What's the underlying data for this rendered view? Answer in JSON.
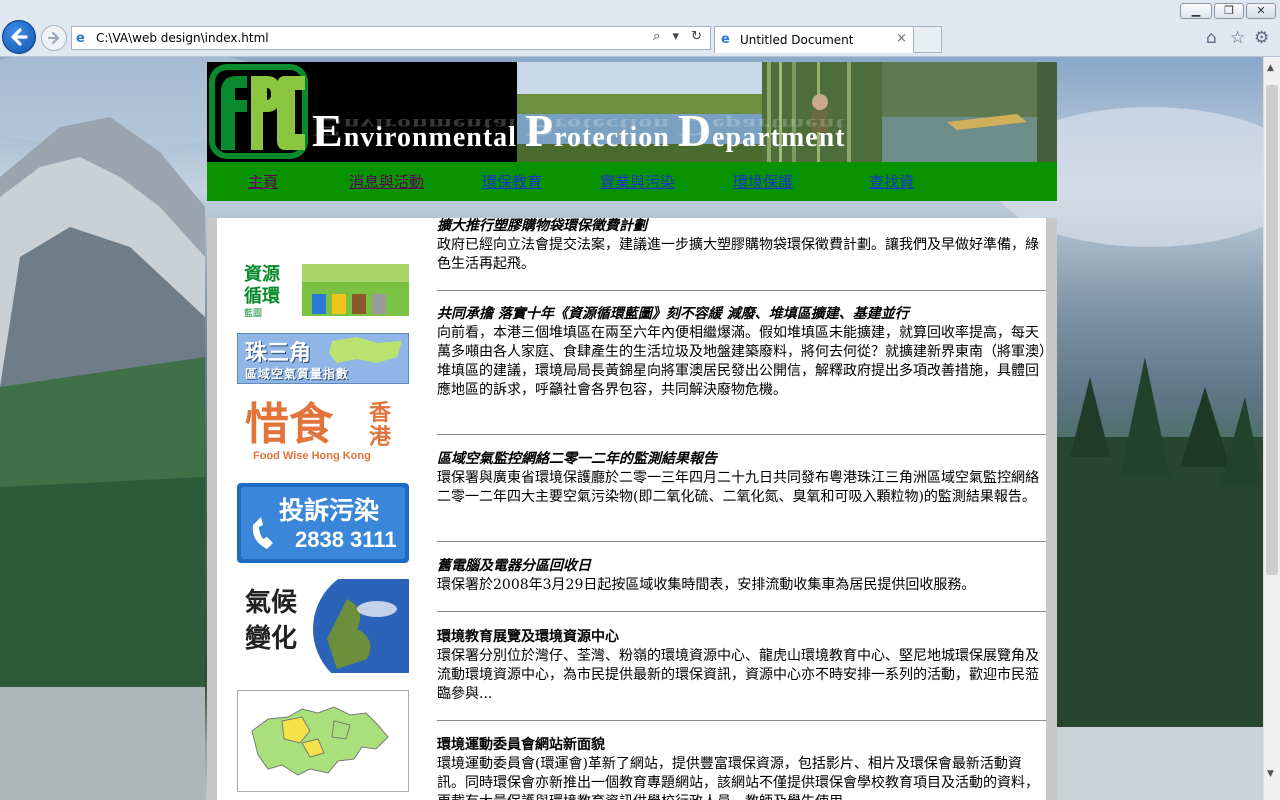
{
  "browser": {
    "address_url": "C:\\VA\\web design\\index.html",
    "tab_title": "Untitled Document",
    "tab_close": "×",
    "address_tools": "⌕ ▾ ↻"
  },
  "banner": {
    "title_e": "E",
    "title_rest1": "nvironmental ",
    "title_p": "P",
    "title_rest2": "rotection ",
    "title_d": "D",
    "title_rest3": "epartment"
  },
  "nav": {
    "items": [
      {
        "label": "主頁",
        "color": "#5a005a"
      },
      {
        "label": "消息與活動",
        "color": "#5a005a"
      },
      {
        "label": "環保教育",
        "color": "#1a35c8"
      },
      {
        "label": "實業與污染",
        "color": "#1a35c8"
      },
      {
        "label": "環境保護",
        "color": "#1a35c8"
      },
      {
        "label": "查找資",
        "color": "#1a35c8"
      }
    ]
  },
  "sidebar": {
    "recycle_text": "資源\n循環",
    "recycle_sub": "藍圖",
    "prd_text": "珠三角",
    "prd_sub": "區域空氣質量指數",
    "foodwise_cn": "惜食",
    "foodwise_cn2": "香港",
    "foodwise_en": "Food Wise Hong Kong",
    "complaint_text": "投訴污染",
    "complaint_phone": "2838 3111",
    "climate_text": "氣候\n變化"
  },
  "articles": [
    {
      "title": "擴大推行塑膠購物袋環保徵費計劃",
      "body": "政府已經向立法會提交法案，建議進一步擴大塑膠購物袋環保徵費計劃。讓我們及早做好準備，綠色生活再起飛。"
    },
    {
      "title": "共同承擔 落實十年《資源循環藍圖》刻不容緩 減廢、堆填區擴建、基建並行",
      "body": "向前看，本港三個堆填區在兩至六年內便相繼爆滿。假如堆填區未能擴建，就算回收率提高，每天萬多噸由各人家庭、食肆產生的生活垃圾及地盤建築廢料，將何去何從？就擴建新界東南（將軍澳）堆填區的建議，環境局局長黃錦星向將軍澳居民發出公開信，解釋政府提出多項改善措施，具體回應地區的訴求，呼籲社會各界包容，共同解決廢物危機。"
    },
    {
      "title": "區域空氣監控網絡二零一二年的監測結果報告",
      "body": "環保署與廣東省環境保護廳於二零一三年四月二十九日共同發布粵港珠江三角洲區域空氣監控網絡二零一二年四大主要空氣污染物(即二氧化硫、二氧化氮、臭氧和可吸入顆粒物)的監測結果報告。"
    },
    {
      "title": "舊電腦及電器分區回收日",
      "body": "環保署於2008年3月29日起按區域收集時間表，安排流動收集車為居民提供回收服務。"
    },
    {
      "title": "環境教育展覽及環境資源中心",
      "body": "環保署分別位於灣仔、荃灣、粉嶺的環境資源中心、龍虎山環境教育中心、堅尼地城環保展覽角及流動環境資源中心，為市民提供最新的環保資訊，資源中心亦不時安排一系列的活動，歡迎市民蒞臨參與..."
    },
    {
      "title": "環境運動委員會網站新面貌",
      "body": "環境運動委員會(環運會)革新了網站，提供豐富環保資源，包括影片、相片及環保會最新活動資訊。同時環保會亦新推出一個教育專題網站，該網站不僅提供環保會學校教育項目及活動的資料，更載有大量保護與環境教育資訊供學校行政人員、教師及學生使用。"
    }
  ],
  "colors": {
    "nav_green": "#0a9300",
    "logo_green": "#0a8a2e",
    "logo_lightgreen": "#8cc63f"
  }
}
